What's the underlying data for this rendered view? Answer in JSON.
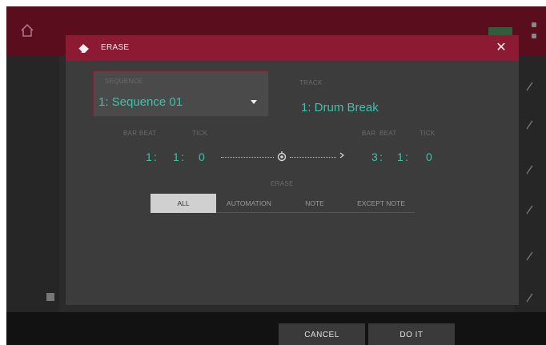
{
  "dialog": {
    "title": "ERASE",
    "close_symbol": "✕",
    "sequence_label": "SEQUENCE",
    "sequence_value": "1: Sequence 01",
    "track_label": "TRACK",
    "track_value": "1: Drum Break",
    "range": {
      "headers": [
        "BAR",
        "BEAT",
        "TICK"
      ],
      "start": {
        "bar": "1",
        "beat": "1",
        "tick": "0"
      },
      "end": {
        "bar": "3",
        "beat": "1",
        "tick": "0"
      },
      "separator": ":"
    },
    "erase_label": "ERASE",
    "erase_options": [
      "ALL",
      "AUTOMATION",
      "NOTE",
      "EXCEPT NOTE"
    ],
    "erase_selected": "ALL"
  },
  "footer": {
    "cancel_label": "CANCEL",
    "doit_label": "DO IT"
  },
  "colors": {
    "accent": "#8c1a32",
    "value": "#3fc2a8"
  },
  "icons": [
    "home-icon",
    "eraser-icon",
    "close-icon",
    "chevron-down-icon",
    "knob-icon",
    "arrow-right-icon"
  ]
}
